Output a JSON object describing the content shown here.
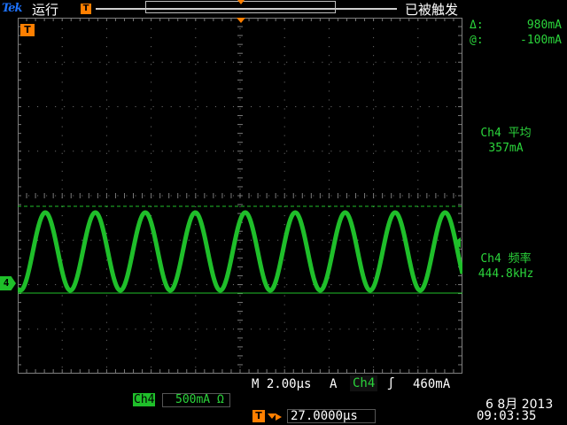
{
  "header": {
    "logo": "Tek",
    "run_status": "运行",
    "trigger_status": "已被触发"
  },
  "markers": {
    "trigger_position": "T",
    "channel_ground": "4"
  },
  "cursor_readout": {
    "delta_label": "Δ:",
    "delta_value": "980mA",
    "at_label": "@:",
    "at_value": "-100mA"
  },
  "measurements": [
    {
      "label": "Ch4 平均",
      "value": "357mA"
    },
    {
      "label": "Ch4 频率",
      "value": "444.8kHz"
    }
  ],
  "bottom": {
    "timebase": "M 2.00μs",
    "acq_mode": "A",
    "trigger_source": "Ch4",
    "trigger_slope": "ʃ",
    "trigger_level": "460mA",
    "channel": "Ch4",
    "channel_scale": "500mA Ω",
    "delay_icon": "T",
    "delay": "27.0000μs",
    "date": "6 8月 2013",
    "time": "09:03:35"
  },
  "colors": {
    "ch4": "#1fbf2a",
    "trigger": "#ff7f00",
    "grid": "#7a7a7a"
  },
  "waveform": {
    "channel": "Ch4",
    "cycles_visible": 8.9,
    "amplitude_mA": 980,
    "mean_mA": 357,
    "frequency_kHz": 444.8
  }
}
